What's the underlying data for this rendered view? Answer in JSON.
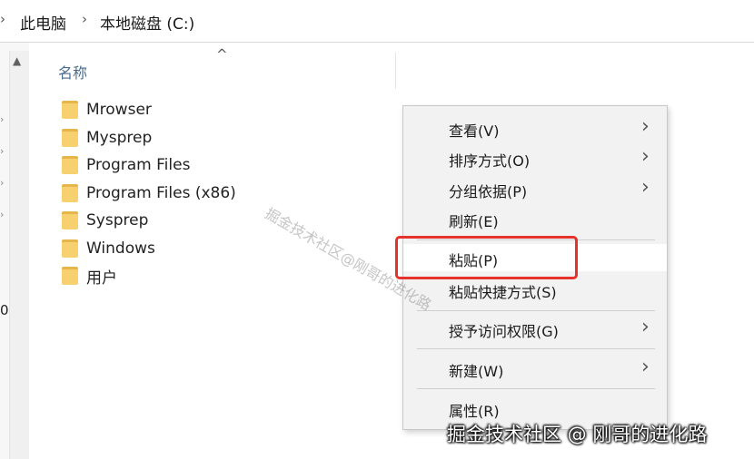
{
  "breadcrumb": {
    "items": [
      "此电脑",
      "本地磁盘 (C:)"
    ]
  },
  "nav": {
    "partial_label": "0"
  },
  "file_list": {
    "column_header": "名称",
    "files": [
      {
        "name": "Mrowser",
        "icon": "folder-icon"
      },
      {
        "name": "Mysprep",
        "icon": "folder-icon"
      },
      {
        "name": "Program Files",
        "icon": "folder-icon"
      },
      {
        "name": "Program Files (x86)",
        "icon": "folder-icon"
      },
      {
        "name": "Sysprep",
        "icon": "folder-icon"
      },
      {
        "name": "Windows",
        "icon": "folder-icon"
      },
      {
        "name": "用户",
        "icon": "folder-icon"
      }
    ]
  },
  "context_menu": {
    "items": [
      {
        "label": "查看(V)",
        "has_submenu": true
      },
      {
        "label": "排序方式(O)",
        "has_submenu": true
      },
      {
        "label": "分组依据(P)",
        "has_submenu": true
      },
      {
        "label": "刷新(E)",
        "has_submenu": false
      },
      {
        "label": "粘贴(P)",
        "has_submenu": false,
        "highlighted": true
      },
      {
        "label": "粘贴快捷方式(S)",
        "has_submenu": false
      },
      {
        "label": "授予访问权限(G)",
        "has_submenu": true
      },
      {
        "label": "新建(W)",
        "has_submenu": true
      },
      {
        "label": "属性(R)",
        "has_submenu": false
      }
    ],
    "highlight_color": "#e5322d"
  },
  "watermark": {
    "diagonal": "掘金技术社区@刚哥的进化路",
    "corner": "掘金技术社区 @ 刚哥的进化路"
  },
  "icons": {
    "breadcrumb_separator": "›",
    "submenu_arrow": "›",
    "sort_indicator": "^",
    "nav_expand": "›"
  }
}
